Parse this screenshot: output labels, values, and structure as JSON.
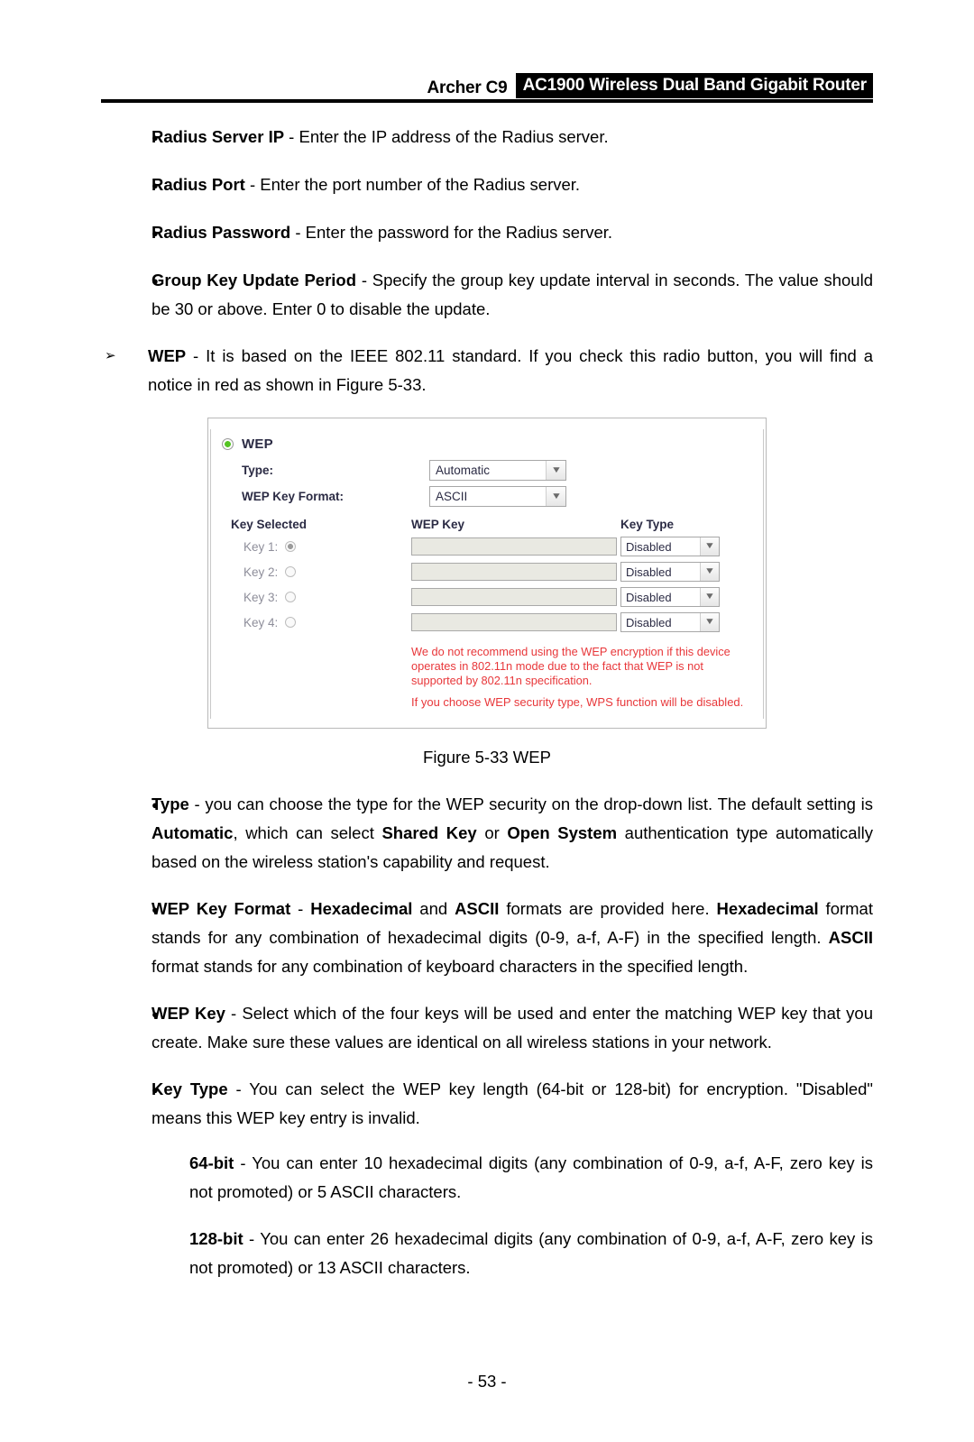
{
  "header": {
    "model": "Archer C9",
    "product": "AC1900 Wireless Dual Band Gigabit Router"
  },
  "bullets": [
    {
      "term": "Radius Server IP",
      "sep": " - ",
      "text": "Enter the IP address of the Radius server."
    },
    {
      "term": "Radius Port",
      "sep": " - ",
      "text": "Enter the port number of the Radius server."
    },
    {
      "term": "Radius Password",
      "sep": " - ",
      "text": "Enter the password for the Radius server."
    },
    {
      "term": "Group Key Update Period",
      "sep": " - ",
      "text": "Specify the group key update interval in seconds. The value should be 30 or above. Enter 0 to disable the update."
    }
  ],
  "wep_intro": {
    "marker": "arrow",
    "term": "WEP",
    "sep": " - ",
    "text": "It is based on the IEEE 802.11 standard. If you check this radio button, you will find a notice in red as shown in Figure 5-33."
  },
  "figure": {
    "caption": "Figure 5-33 WEP",
    "panel": {
      "radio_label": "WEP",
      "radio_selected": true,
      "fields": [
        {
          "label": "Type:",
          "value": "Automatic"
        },
        {
          "label": "WEP Key Format:",
          "value": "ASCII"
        }
      ],
      "columns": {
        "key_selected": "Key Selected",
        "wep_key": "WEP Key",
        "key_type": "Key Type"
      },
      "keys": [
        {
          "label": "Key 1:",
          "selected": true,
          "value": "",
          "key_type": "Disabled"
        },
        {
          "label": "Key 2:",
          "selected": false,
          "value": "",
          "key_type": "Disabled"
        },
        {
          "label": "Key 3:",
          "selected": false,
          "value": "",
          "key_type": "Disabled"
        },
        {
          "label": "Key 4:",
          "selected": false,
          "value": "",
          "key_type": "Disabled"
        }
      ],
      "notices": [
        "We do not recommend using the WEP encryption if this device operates in 802.11n mode due to the fact that WEP is not supported by 802.11n specification.",
        "If you choose WEP security type, WPS function will be disabled."
      ],
      "notice_color": "#e8373a",
      "radio_color": "#55c423"
    }
  },
  "body_bullets": [
    {
      "id": "type",
      "parts": [
        {
          "b": true,
          "t": "Type"
        },
        {
          "b": false,
          "t": " - you can choose the type for the WEP security on the drop-down list. The default setting is "
        },
        {
          "b": true,
          "t": "Automatic"
        },
        {
          "b": false,
          "t": ", which can select "
        },
        {
          "b": true,
          "t": "Shared Key"
        },
        {
          "b": false,
          "t": " or "
        },
        {
          "b": true,
          "t": "Open System"
        },
        {
          "b": false,
          "t": " authentication type automatically based on the wireless station's capability and request."
        }
      ]
    },
    {
      "id": "wep-key-format",
      "parts": [
        {
          "b": true,
          "t": "WEP Key Format"
        },
        {
          "b": false,
          "t": " - "
        },
        {
          "b": true,
          "t": "Hexadecimal"
        },
        {
          "b": false,
          "t": " and "
        },
        {
          "b": true,
          "t": "ASCII"
        },
        {
          "b": false,
          "t": " formats are provided here. "
        },
        {
          "b": true,
          "t": "Hexadecimal"
        },
        {
          "b": false,
          "t": " format stands for any combination of hexadecimal digits (0-9, a-f, A-F) in the specified length. "
        },
        {
          "b": true,
          "t": "ASCII"
        },
        {
          "b": false,
          "t": " format stands for any combination of keyboard characters in the specified length."
        }
      ]
    },
    {
      "id": "wep-key",
      "parts": [
        {
          "b": true,
          "t": "WEP Key"
        },
        {
          "b": false,
          "t": " - Select which of the four keys will be used and enter the matching WEP key that you create. Make sure these values are identical on all wireless stations in your network."
        }
      ]
    },
    {
      "id": "key-type",
      "parts": [
        {
          "b": true,
          "t": "Key Type"
        },
        {
          "b": false,
          "t": " - You can select the WEP key length (64-bit or 128-bit) for encryption. \"Disabled\" means this WEP key entry is invalid."
        }
      ]
    }
  ],
  "sub_paragraphs": [
    {
      "id": "64-bit",
      "parts": [
        {
          "b": true,
          "t": "64-bit"
        },
        {
          "b": false,
          "t": " - You can enter 10 hexadecimal digits (any combination of 0-9, a-f, A-F, zero key is not promoted) or 5 ASCII characters."
        }
      ]
    },
    {
      "id": "128-bit",
      "parts": [
        {
          "b": true,
          "t": "128-bit"
        },
        {
          "b": false,
          "t": " - You can enter 26 hexadecimal digits (any combination of 0-9, a-f, A-F, zero key is not promoted) or 13 ASCII characters."
        }
      ]
    }
  ],
  "footer": {
    "page_number": "- 53 -"
  }
}
